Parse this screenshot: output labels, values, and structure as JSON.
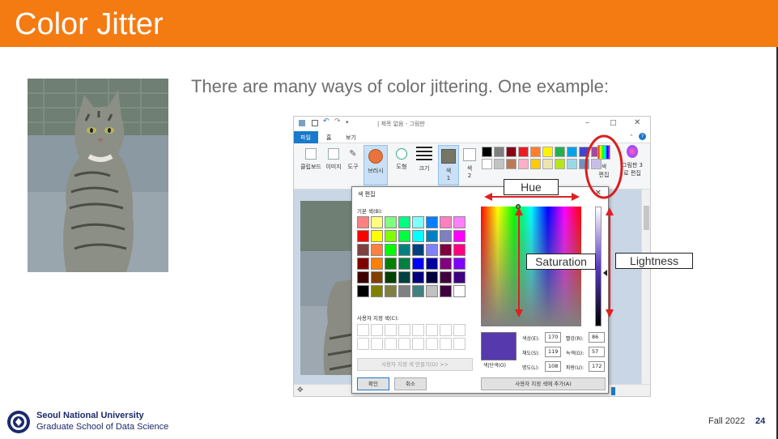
{
  "slide": {
    "title": "Color Jitter",
    "subtitle": "There are many ways of color jittering. One example:",
    "footer": {
      "university": "Seoul National University",
      "school": "Graduate School of Data Science",
      "term": "Fall 2022",
      "page": "24"
    },
    "accent_color": "#f47b12"
  },
  "annotations": {
    "hue": "Hue",
    "saturation": "Saturation",
    "lightness": "Lightness",
    "arrow_color": "#e02020"
  },
  "paint": {
    "window_title": "| 제목 없음 - 그림판",
    "tabs": [
      "파일",
      "홈",
      "보기"
    ],
    "ribbon": {
      "clipboard": "클립보드",
      "image": "이미지",
      "tools": "도구",
      "brushes": "브러시",
      "shapes": "도형",
      "size": "크기",
      "color1_top": "색",
      "color1_bottom": "1",
      "color2_top": "색",
      "color2_bottom": "2",
      "edit_colors_top": "색",
      "edit_colors_bottom": "편집",
      "paint3d_top": "그림판 3",
      "paint3d_bottom": "로 편집"
    },
    "palette_colors": [
      "#000000",
      "#7f7f7f",
      "#880015",
      "#ed1c24",
      "#ff7f27",
      "#fff200",
      "#22b14c",
      "#00a2e8",
      "#3f48cc",
      "#a349a4",
      "#ffffff",
      "#c3c3c3",
      "#b97a57",
      "#ffaec9",
      "#ffc90e",
      "#efe4b0",
      "#b5e61d",
      "#99d9ea",
      "#7092be",
      "#c8bfe7"
    ]
  },
  "edit_colors_dialog": {
    "title": "색 편집",
    "basic_colors_label": "기본 색(B):",
    "custom_colors_label": "사용자 지정 색(C):",
    "define_custom_button": "사용자 지정 색 만들기(D) >>",
    "ok_button": "확인",
    "cancel_button": "취소",
    "add_custom_button": "사용자 지정 색에 추가(A)",
    "color_solid_label": "색|단색(O)",
    "fields": [
      {
        "label": "색상(E):",
        "value": "170"
      },
      {
        "label": "채도(S):",
        "value": "119"
      },
      {
        "label": "명도(L):",
        "value": "108"
      },
      {
        "label": "빨강(R):",
        "value": "86"
      },
      {
        "label": "녹색(G):",
        "value": "57"
      },
      {
        "label": "파랑(U):",
        "value": "172"
      }
    ],
    "selected_color": "#5639ac",
    "basic_colors": [
      "#ff8080",
      "#ffff80",
      "#80ff80",
      "#00ff80",
      "#80ffff",
      "#0080ff",
      "#ff80c0",
      "#ff80ff",
      "#ff0000",
      "#ffff00",
      "#80ff00",
      "#00ff40",
      "#00ffff",
      "#0080c0",
      "#8080c0",
      "#ff00ff",
      "#804040",
      "#ff8040",
      "#00ff00",
      "#008080",
      "#004080",
      "#8080ff",
      "#800040",
      "#ff0080",
      "#800000",
      "#ff8000",
      "#008000",
      "#008040",
      "#0000ff",
      "#0000a0",
      "#800080",
      "#8000ff",
      "#400000",
      "#804000",
      "#004000",
      "#004040",
      "#000080",
      "#000040",
      "#400040",
      "#400080",
      "#000000",
      "#808000",
      "#808040",
      "#808080",
      "#408080",
      "#c0c0c0",
      "#400040",
      "#ffffff"
    ]
  }
}
